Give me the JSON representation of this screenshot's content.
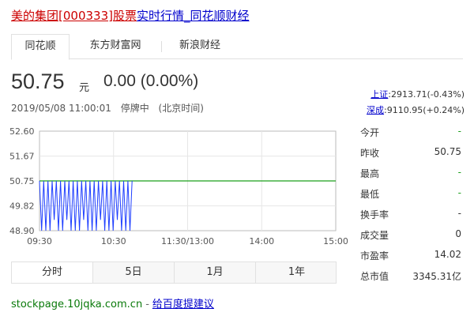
{
  "header": {
    "title_part_red": "美的集团[000333]股票",
    "title_part_blue": "实时行情_同花顺财经"
  },
  "source_tabs": [
    {
      "label": "同花顺",
      "active": true
    },
    {
      "label": "东方财富网",
      "active": false
    },
    {
      "label": "新浪财经",
      "active": false
    }
  ],
  "quote": {
    "price": "50.75",
    "unit": "元",
    "change": "0.00 (0.00%)",
    "datetime": "2019/05/08 11:00:01",
    "status": "停牌中",
    "timezone": "(北京时间)"
  },
  "indices": [
    {
      "name": "上证",
      "value": ":2913.71(-0.43%)"
    },
    {
      "name": "深成",
      "value": ":9110.95(+0.24%)"
    }
  ],
  "stats": [
    {
      "label": "今开",
      "value": "-",
      "color": "#1a9f1a"
    },
    {
      "label": "昨收",
      "value": "50.75",
      "color": "#333333"
    },
    {
      "label": "最高",
      "value": "-",
      "color": "#1a9f1a"
    },
    {
      "label": "最低",
      "value": "-",
      "color": "#1a9f1a"
    },
    {
      "label": "换手率",
      "value": "-",
      "color": "#333333"
    },
    {
      "label": "成交量",
      "value": "0",
      "color": "#333333"
    },
    {
      "label": "市盈率",
      "value": "14.02",
      "color": "#333333"
    },
    {
      "label": "总市值",
      "value": "3345.31亿",
      "color": "#333333"
    }
  ],
  "range_tabs": [
    {
      "label": "分时",
      "active": true
    },
    {
      "label": "5日",
      "active": false
    },
    {
      "label": "1月",
      "active": false
    },
    {
      "label": "1年",
      "active": false
    }
  ],
  "footer": {
    "site": "stockpage.10jqka.com.cn",
    "dash": "-",
    "feedback": "给百度提建议"
  },
  "chart_data": {
    "type": "line",
    "title": "",
    "xlabel": "",
    "ylabel": "",
    "x_ticks": [
      "09:30",
      "10:30",
      "11:30/13:00",
      "14:00",
      "15:00"
    ],
    "y_ticks": [
      "52.60",
      "51.67",
      "50.75",
      "49.82",
      "48.90"
    ],
    "ylim": [
      48.9,
      52.6
    ],
    "grid": true,
    "reference_line": {
      "name": "昨收",
      "value": 50.75,
      "color": "#1a9f1a"
    },
    "series": [
      {
        "color": "#1f3fff",
        "x_range_minutes": [
          0,
          75
        ],
        "values": [
          50.75,
          48.9,
          50.75,
          48.9,
          50.75,
          48.9,
          50.75,
          49.3,
          50.75,
          48.9,
          50.75,
          48.9,
          50.75,
          49.3,
          50.75,
          48.9,
          50.75,
          48.9,
          50.75,
          48.9,
          50.75,
          49.3,
          50.75,
          48.9,
          50.75,
          48.9,
          50.75,
          48.9,
          50.75,
          49.3,
          50.75,
          48.9,
          50.75,
          48.9,
          50.75,
          48.9,
          50.75,
          49.3,
          50.75,
          48.9,
          50.75,
          48.9,
          50.75,
          48.9,
          50.75
        ]
      }
    ]
  }
}
